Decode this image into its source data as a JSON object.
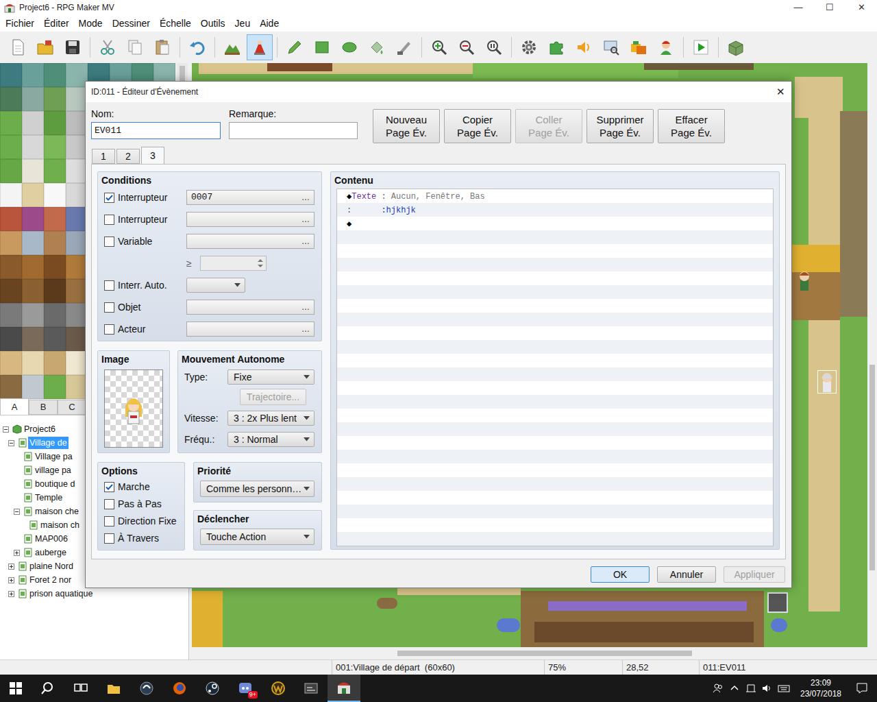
{
  "window": {
    "title": "Project6 - RPG Maker MV",
    "controls": [
      "—",
      "☐",
      "✕"
    ]
  },
  "menu": [
    "Fichier",
    "Éditer",
    "Mode",
    "Dessiner",
    "Échelle",
    "Outils",
    "Jeu",
    "Aide"
  ],
  "toolbar": [
    [
      {
        "selected": false
      },
      {
        "selected": false
      },
      {
        "selected": false
      }
    ],
    [
      {
        "selected": false
      },
      {
        "selected": false
      },
      {
        "selected": false
      }
    ],
    [
      {
        "selected": false
      }
    ],
    [
      {
        "selected": false
      },
      {
        "selected": true
      }
    ],
    [
      {
        "selected": false
      },
      {
        "selected": false
      },
      {
        "selected": false
      },
      {
        "selected": false
      },
      {
        "selected": false
      }
    ],
    [
      {
        "selected": false
      },
      {
        "selected": false
      },
      {
        "selected": false
      }
    ],
    [
      {
        "selected": false
      },
      {
        "selected": false
      },
      {
        "selected": false
      },
      {
        "selected": false
      },
      {
        "selected": false
      },
      {
        "selected": false
      }
    ],
    [
      {
        "selected": false
      }
    ],
    [
      {
        "selected": false
      }
    ]
  ],
  "tileset_tabs": [
    {
      "label": "A",
      "selected": true
    },
    {
      "label": "B",
      "selected": false
    },
    {
      "label": "C",
      "selected": false
    }
  ],
  "map_tree": [
    {
      "label": "Project6",
      "depth": 0,
      "kind": "branch",
      "expanded": true,
      "selected": false
    },
    {
      "label": "Village de",
      "depth": 1,
      "kind": "branch",
      "expanded": true,
      "selected": true
    },
    {
      "label": "Village pa",
      "depth": 2,
      "kind": "leaf",
      "selected": false
    },
    {
      "label": "village pa",
      "depth": 2,
      "kind": "leaf",
      "selected": false
    },
    {
      "label": "boutique d",
      "depth": 2,
      "kind": "leaf",
      "selected": false
    },
    {
      "label": "Temple",
      "depth": 2,
      "kind": "leaf",
      "selected": false
    },
    {
      "label": "maison che",
      "depth": 2,
      "kind": "branch",
      "expanded": true,
      "selected": false
    },
    {
      "label": "maison ch",
      "depth": 3,
      "kind": "leaf",
      "selected": false
    },
    {
      "label": "MAP006",
      "depth": 2,
      "kind": "leaf",
      "selected": false
    },
    {
      "label": "auberge",
      "depth": 2,
      "kind": "branch",
      "expanded": false,
      "selected": false
    },
    {
      "label": "plaine Nord",
      "depth": 1,
      "kind": "branch",
      "expanded": false,
      "selected": false
    },
    {
      "label": "Foret 2 nor",
      "depth": 1,
      "kind": "branch",
      "expanded": false,
      "selected": false
    },
    {
      "label": "prison aquatique",
      "depth": 1,
      "kind": "branch",
      "expanded": false,
      "selected": false
    }
  ],
  "dialog": {
    "title": "ID:011 - Éditeur d'Évènement",
    "close": "✕",
    "name": {
      "label": "Nom:",
      "value": "EV011"
    },
    "note": {
      "label": "Remarque:",
      "value": ""
    },
    "page_buttons": [
      {
        "lines": [
          "Nouveau",
          "Page Év."
        ],
        "disabled": false
      },
      {
        "lines": [
          "Copier",
          "Page Év."
        ],
        "disabled": false
      },
      {
        "lines": [
          "Coller",
          "Page Év."
        ],
        "disabled": true
      },
      {
        "lines": [
          "Supprimer",
          "Page Év."
        ],
        "disabled": false
      },
      {
        "lines": [
          "Effacer",
          "Page Év."
        ],
        "disabled": false
      }
    ],
    "pages": [
      {
        "label": "1",
        "selected": false
      },
      {
        "label": "2",
        "selected": false
      },
      {
        "label": "3",
        "selected": true
      }
    ],
    "conditions": {
      "title": "Conditions",
      "rows": [
        {
          "kind": "picker",
          "label": "Interrupteur",
          "checked": true,
          "value": "0007",
          "button": "…"
        },
        {
          "kind": "picker",
          "label": "Interrupteur",
          "checked": false,
          "value": "",
          "button": "…"
        },
        {
          "kind": "picker",
          "label": "Variable",
          "checked": false,
          "value": "",
          "button": "…"
        },
        {
          "kind": "compare",
          "label": "≥",
          "value": ""
        },
        {
          "kind": "dropdown",
          "label": "Interr. Auto.",
          "checked": false,
          "value": ""
        },
        {
          "kind": "picker",
          "label": "Objet",
          "checked": false,
          "value": "",
          "button": "…"
        },
        {
          "kind": "picker",
          "label": "Acteur",
          "checked": false,
          "value": "",
          "button": "…"
        }
      ]
    },
    "image": {
      "title": "Image"
    },
    "movement": {
      "title": "Mouvement Autonome",
      "type": {
        "label": "Type:",
        "value": "Fixe"
      },
      "route": {
        "label": "Trajectoire...",
        "disabled": true
      },
      "speed": {
        "label": "Vitesse:",
        "value": "3 : 2x Plus lent"
      },
      "frequency": {
        "label": "Fréqu.:",
        "value": "3 : Normal"
      }
    },
    "options": {
      "title": "Options",
      "items": [
        {
          "label": "Marche",
          "checked": true
        },
        {
          "label": "Pas à Pas",
          "checked": false
        },
        {
          "label": "Direction Fixe",
          "checked": false
        },
        {
          "label": "À Travers",
          "checked": false
        }
      ]
    },
    "priority": {
      "title": "Priorité",
      "value": "Comme les personn…"
    },
    "trigger": {
      "title": "Déclencher",
      "value": "Touche Action"
    },
    "contents": {
      "title": "Contenu",
      "lines": [
        {
          "parts": [
            {
              "text": "◆",
              "color": "#000000"
            },
            {
              "text": "Texte",
              "color": "#6a2fa0"
            },
            {
              "text": " : ",
              "color": "#666666"
            },
            {
              "text": "Aucun, Fenêtre, Bas",
              "color": "#777777"
            }
          ]
        },
        {
          "parts": [
            {
              "text": ":",
              "color": "#555555"
            },
            {
              "text": "      :hjkhjk",
              "color": "#2040b0"
            }
          ]
        },
        {
          "parts": [
            {
              "text": "◆",
              "color": "#000000"
            }
          ]
        }
      ]
    },
    "buttons": [
      {
        "label": "OK",
        "disabled": false,
        "default": true
      },
      {
        "label": "Annuler",
        "disabled": false,
        "default": false
      },
      {
        "label": "Appliquer",
        "disabled": true,
        "default": false
      }
    ]
  },
  "status_bar": [
    "001:Village de départ  (60x60)",
    "75%",
    "28,52",
    "011:EV011"
  ],
  "taskbar": {
    "apps": [
      {
        "active": false
      },
      {
        "active": false
      },
      {
        "active": false
      },
      {
        "active": false
      },
      {
        "active": false
      },
      {
        "active": false
      },
      {
        "active": false,
        "badge": "9+"
      },
      {
        "active": false
      },
      {
        "active": false
      },
      {
        "active": true
      }
    ],
    "time": "23:09",
    "date": "23/07/2018"
  }
}
